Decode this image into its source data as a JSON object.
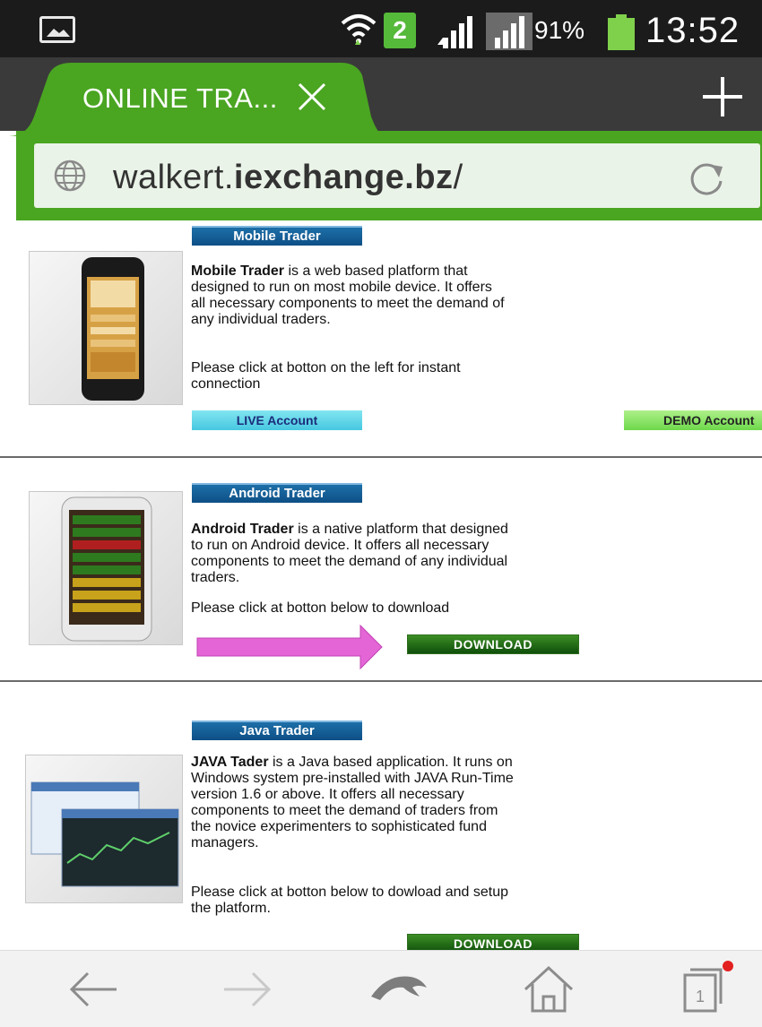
{
  "status_bar": {
    "sim_slot": "2",
    "battery_percent": "91%",
    "time": "13:52",
    "icons": [
      "image-icon",
      "wifi-icon",
      "sim-icon",
      "signal-icon",
      "signal-roaming-icon",
      "battery-icon"
    ]
  },
  "browser": {
    "tab_title": "ONLINE TRA...",
    "url_prefix": "walkert.",
    "url_domain": "iexchange.bz",
    "url_suffix": "/",
    "colors": {
      "accent": "#4aa521",
      "tab_strip": "#3a3a3a",
      "status_bar": "#1b1b1b"
    },
    "tab_count": "1"
  },
  "sections": {
    "mobile": {
      "title": "Mobile Trader",
      "desc_bold": "Mobile Trader",
      "desc_rest": " is a web based platform that designed to run on most mobile device. It offers all necessary components to meet the demand of any individual traders.",
      "instruction": "Please click at botton on the left for instant connection",
      "live_button": "LIVE Account",
      "demo_button": "DEMO Account"
    },
    "android": {
      "title": "Android Trader",
      "desc_bold": "Android Trader",
      "desc_rest": " is a native platform that designed to run on Android device. It offers all necessary components to meet the demand of any individual traders.",
      "instruction": "Please click at botton below to download",
      "download_button": "DOWNLOAD"
    },
    "java": {
      "title": "Java Trader",
      "desc_bold": "JAVA Tader",
      "desc_rest": " is a Java based application. It runs on Windows system pre-installed with JAVA Run-Time version 1.6 or above. It offers all necessary components to meet the demand of traders from the novice experimenters to sophisticated fund managers.",
      "instruction": "Please click at botton below to dowload and setup the platform.",
      "download_button": "DOWNLOAD"
    }
  }
}
